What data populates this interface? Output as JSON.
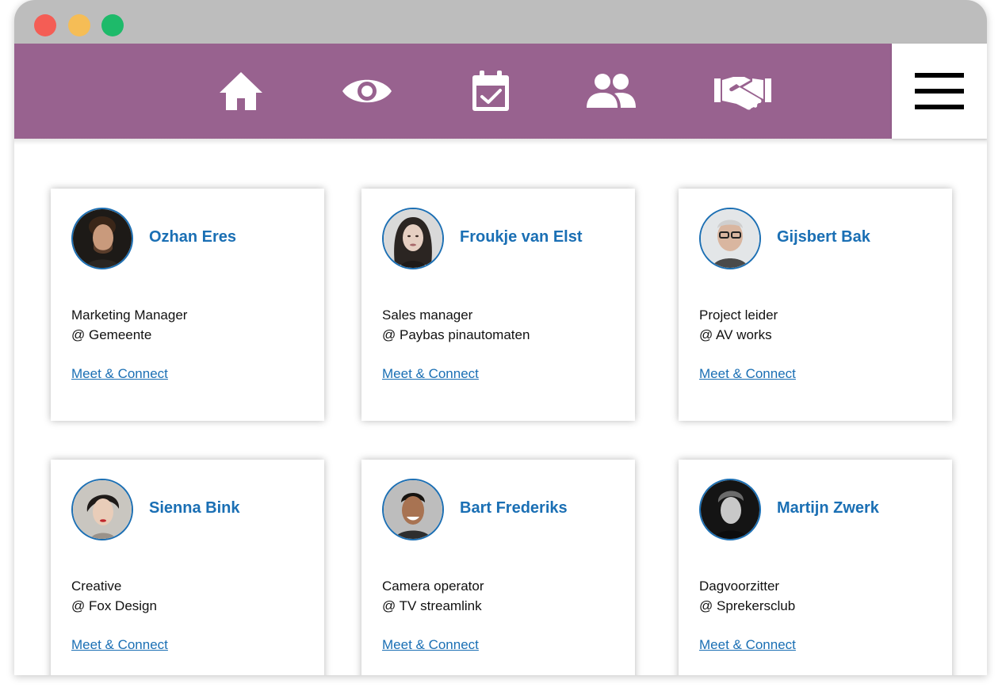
{
  "colors": {
    "nav_background": "#98628f",
    "accent_blue": "#1a6fb4",
    "titlebar": "#bdbdbd"
  },
  "nav": {
    "items": [
      {
        "icon": "home-icon"
      },
      {
        "icon": "eye-icon"
      },
      {
        "icon": "calendar-check-icon"
      },
      {
        "icon": "people-icon"
      },
      {
        "icon": "handshake-icon"
      }
    ],
    "menu_icon": "hamburger-menu-icon"
  },
  "people": [
    {
      "name": "Ozhan Eres",
      "role": "Marketing Manager",
      "company": "@ Gemeente",
      "link": "Meet & Connect"
    },
    {
      "name": "Froukje van Elst",
      "role": "Sales manager",
      "company": "@ Paybas pinautomaten",
      "link": "Meet & Connect"
    },
    {
      "name": "Gijsbert Bak",
      "role": "Project leider",
      "company": "@ AV works",
      "link": "Meet & Connect"
    },
    {
      "name": "Sienna Bink",
      "role": "Creative",
      "company": "@ Fox Design",
      "link": "Meet & Connect"
    },
    {
      "name": "Bart Frederiks",
      "role": "Camera operator",
      "company": "@ TV streamlink",
      "link": "Meet & Connect"
    },
    {
      "name": "Martijn Zwerk",
      "role": "Dagvoorzitter",
      "company": "@ Sprekersclub",
      "link": "Meet & Connect"
    }
  ]
}
